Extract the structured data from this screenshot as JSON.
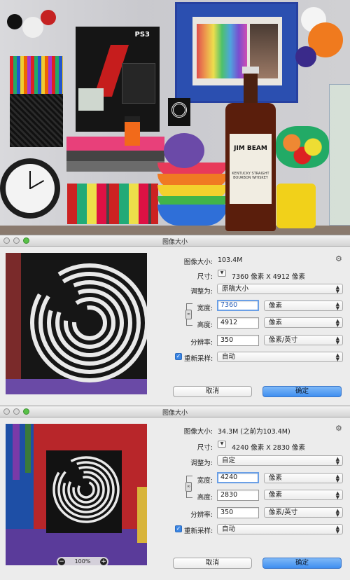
{
  "dialogs": [
    {
      "title": "图像大小",
      "image_size_label": "图像大小:",
      "image_size_value": "103.4M",
      "dimensions_label": "尺寸:",
      "dimensions_value": "7360 像素  X  4912 像素",
      "fit_to_label": "调整为:",
      "fit_to_value": "原稿大小",
      "width_label": "宽度:",
      "width_value": "7360",
      "width_unit": "像素",
      "height_label": "高度:",
      "height_value": "4912",
      "height_unit": "像素",
      "resolution_label": "分辨率:",
      "resolution_value": "350",
      "resolution_unit": "像素/英寸",
      "resample_label": "重新采样:",
      "resample_value": "自动",
      "cancel_label": "取消",
      "ok_label": "确定"
    },
    {
      "title": "图像大小",
      "image_size_label": "图像大小:",
      "image_size_value": "34.3M (之前为103.4M)",
      "dimensions_label": "尺寸:",
      "dimensions_value": "4240 像素  X  2830 像素",
      "fit_to_label": "调整为:",
      "fit_to_value": "自定",
      "width_label": "宽度:",
      "width_value": "4240",
      "width_unit": "像素",
      "height_label": "高度:",
      "height_value": "2830",
      "height_unit": "像素",
      "resolution_label": "分辨率:",
      "resolution_value": "350",
      "resolution_unit": "像素/英寸",
      "resample_label": "重新采样:",
      "resample_value": "自动",
      "cancel_label": "取消",
      "ok_label": "确定",
      "zoom_value": "100%"
    }
  ],
  "photo": {
    "ps3_label": "PS3",
    "bottle_brand": "JIM BEAM",
    "bottle_sub": "KENTUCKY STRAIGHT BOURBON WHISKEY"
  }
}
